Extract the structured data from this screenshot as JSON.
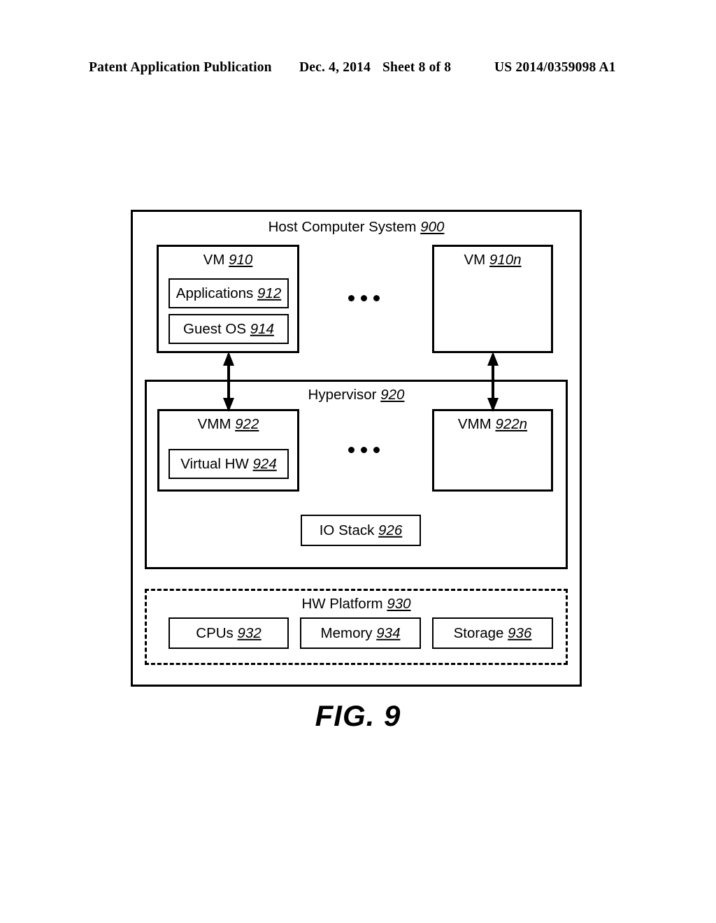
{
  "header": {
    "publication": "Patent Application Publication",
    "date": "Dec. 4, 2014",
    "sheet": "Sheet 8 of 8",
    "number": "US 2014/0359098 A1"
  },
  "figure": {
    "caption": "FIG. 9",
    "host": {
      "label": "Host Computer System",
      "ref": "900"
    },
    "vms": [
      {
        "label": "VM",
        "ref": "910",
        "children": [
          {
            "label": "Applications",
            "ref": "912"
          },
          {
            "label": "Guest OS",
            "ref": "914"
          }
        ]
      },
      {
        "label": "VM",
        "ref": "910n",
        "children": []
      }
    ],
    "vm_ellipsis": "• • •",
    "hypervisor": {
      "label": "Hypervisor",
      "ref": "920",
      "vmms": [
        {
          "label": "VMM",
          "ref": "922",
          "children": [
            {
              "label": "Virtual HW",
              "ref": "924"
            }
          ]
        },
        {
          "label": "VMM",
          "ref": "922n",
          "children": []
        }
      ],
      "vmm_ellipsis": "• • •",
      "io_stack": {
        "label": "IO Stack",
        "ref": "926"
      }
    },
    "hw_platform": {
      "label": "HW Platform",
      "ref": "930",
      "components": [
        {
          "label": "CPUs",
          "ref": "932"
        },
        {
          "label": "Memory",
          "ref": "934"
        },
        {
          "label": "Storage",
          "ref": "936"
        }
      ]
    },
    "connectors": [
      {
        "name": "vm-910-to-vmm-922",
        "type": "double-headed-arrow"
      },
      {
        "name": "vm-910n-to-vmm-922n",
        "type": "double-headed-arrow"
      }
    ]
  },
  "colors": {
    "ink": "#000000",
    "paper": "#ffffff"
  }
}
